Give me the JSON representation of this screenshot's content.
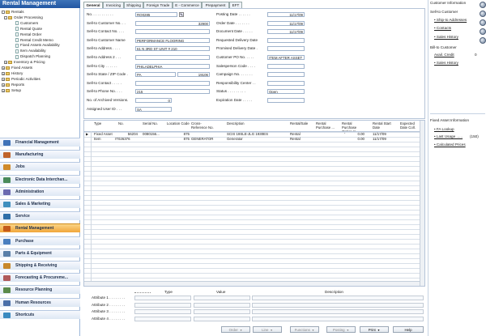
{
  "nav": {
    "title": "Rental Management",
    "tree": [
      {
        "label": "Rentals",
        "expand": "-",
        "icon": "folder"
      },
      {
        "label": "Order Processing",
        "expand": "-",
        "icon": "folder"
      },
      {
        "label": "Customers",
        "expand": "",
        "icon": "doc"
      },
      {
        "label": "Rental Quote",
        "expand": "",
        "icon": "doc"
      },
      {
        "label": "Rental Order",
        "expand": "",
        "icon": "doc"
      },
      {
        "label": "Rental Credit Memo",
        "expand": "",
        "icon": "doc"
      },
      {
        "label": "Fixed Assets Availability",
        "expand": "",
        "icon": "doc"
      },
      {
        "label": "Item Availability",
        "expand": "",
        "icon": "doc"
      },
      {
        "label": "Dispatch Planning",
        "expand": "",
        "icon": "doc"
      },
      {
        "label": "Inventory & Pricing",
        "expand": "+",
        "icon": "folder"
      },
      {
        "label": "Fixed Assets",
        "expand": "+",
        "icon": "folder"
      },
      {
        "label": "History",
        "expand": "+",
        "icon": "folder"
      },
      {
        "label": "Periodic Activities",
        "expand": "+",
        "icon": "folder"
      },
      {
        "label": "Reports",
        "expand": "+",
        "icon": "folder"
      },
      {
        "label": "Setup",
        "expand": "+",
        "icon": "folder"
      }
    ],
    "categories": [
      {
        "label": "Financial Management",
        "color": "#3f72b8",
        "active": false
      },
      {
        "label": "Manufacturing",
        "color": "#c0642a",
        "active": false
      },
      {
        "label": "Jobs",
        "color": "#d08a2a",
        "active": false
      },
      {
        "label": "Electronic Data Interchan...",
        "color": "#4a8a5a",
        "active": false
      },
      {
        "label": "Administration",
        "color": "#6a6ab0",
        "active": false
      },
      {
        "label": "Sales & Marketing",
        "color": "#3f8fbf",
        "active": false
      },
      {
        "label": "Service",
        "color": "#2f6fa8",
        "active": false
      },
      {
        "label": "Rental Management",
        "color": "#c45a1a",
        "active": true
      },
      {
        "label": "Purchase",
        "color": "#4a7fbf",
        "active": false
      },
      {
        "label": "Parts & Equipment",
        "color": "#5a7fa8",
        "active": false
      },
      {
        "label": "Shipping & Receiving",
        "color": "#c8882a",
        "active": false
      },
      {
        "label": "Forecasting & Procureme...",
        "color": "#b05a5a",
        "active": false
      },
      {
        "label": "Resource Planning",
        "color": "#5a8a4a",
        "active": false
      },
      {
        "label": "Human Resources",
        "color": "#4a6fa8",
        "active": false
      },
      {
        "label": "Shortcuts",
        "color": "#3a8ac0",
        "active": false
      }
    ]
  },
  "tabs": [
    "General",
    "Invoicing",
    "Shipping",
    "Foreign Trade",
    "E - Commerce",
    "Prepayment",
    "EFT"
  ],
  "form": {
    "left": [
      {
        "label": "No. . . . . . . . . . .",
        "value": "RO0285",
        "edit": true
      },
      {
        "label": "Sell-to Customer No. . .",
        "value": "32900",
        "right": true
      },
      {
        "label": "Sell-to Contact No. . . .",
        "value": ""
      },
      {
        "label": "Sell-to Customer Name",
        "value": "PERFORMANCE FLOORING"
      },
      {
        "label": "Sell-to Address . . . .",
        "value": "61 N 3RD ST  UNIT # 210"
      },
      {
        "label": "Sell-to Address 2 . . .",
        "value": ""
      },
      {
        "label": "Sell-to City . . . . . .",
        "value": "PHILADELPHIA"
      },
      {
        "label": "Sell-to State / ZIP Code .",
        "value": "PA",
        "value2": "19106"
      },
      {
        "label": "Sell-to Contact . . . . .",
        "value": ""
      },
      {
        "label": "Sell-to Phone No. . . .",
        "value": "215"
      },
      {
        "label": "No. of Archived Versions.",
        "value": "0",
        "right": true,
        "short": true
      },
      {
        "label": "Assigned User ID . . .",
        "value": "SA",
        "short": true
      }
    ],
    "right": [
      {
        "label": "Posting Date . . . . . .",
        "value": "11/17/09",
        "right": true
      },
      {
        "label": "Order Date . . . . . . .",
        "value": "11/17/09",
        "right": true
      },
      {
        "label": "Document Date . . . . .",
        "value": "11/17/09",
        "right": true
      },
      {
        "label": "Requested Delivery Date",
        "value": ""
      },
      {
        "label": "Promised Delivery Date .",
        "value": ""
      },
      {
        "label": "Customer PO No. . . . .",
        "value": "ITEM AFTER ASSET"
      },
      {
        "label": "Salesperson Code . . . .",
        "value": ""
      },
      {
        "label": "Campaign No. . . . . . .",
        "value": ""
      },
      {
        "label": "Responsibility Center . .",
        "value": ""
      },
      {
        "label": "Status . . . . . . . . .",
        "value": "Open"
      },
      {
        "label": "Expiration Date . . . . .",
        "value": ""
      }
    ]
  },
  "lines": {
    "headers": [
      "Type",
      "No.",
      "Serial No.",
      "Location Code",
      "Cross-Reference No.",
      "Description",
      "Rental/Sale",
      "Rental Purchase ...",
      "Rental Purchase Option %",
      "Rental Start Date",
      "Expected Date Coll."
    ],
    "rows": [
      [
        "Fixed Asset",
        "56204",
        "0080156...",
        "875",
        "",
        "SCIS 19SLE-JLG 1930ES",
        "Rental",
        "",
        "0.00",
        "11/17/09",
        ""
      ],
      [
        "Item",
        "IT026376",
        "",
        "875",
        "GENERATOR P...",
        "Generator",
        "Rental",
        "",
        "0.00",
        "11/17/09",
        ""
      ]
    ]
  },
  "attributes": {
    "headers": [
      "Type",
      "Value",
      "Description"
    ],
    "rows": [
      "Attribute 1 . . . . . . . .",
      "Attribute 2 . . . . . . . .",
      "Attribute 3 . . . . . . . .",
      "Attribute 4 . . . . . . . ."
    ]
  },
  "buttons": [
    {
      "label": "Order",
      "enabled": false,
      "dropdown": true
    },
    {
      "label": "Line",
      "enabled": false,
      "dropdown": true
    },
    {
      "label": "Functions",
      "enabled": false,
      "dropdown": true
    },
    {
      "label": "Posting",
      "enabled": false,
      "dropdown": true
    },
    {
      "label": "Print",
      "enabled": true,
      "dropdown": true
    },
    {
      "label": "Help",
      "enabled": true,
      "dropdown": false
    }
  ],
  "factbox": {
    "customer_title": "Customer Information",
    "sell_to": "Sell-to Customer",
    "sell_items": [
      "Ship-to Addresses",
      "Contacts",
      "Sales History"
    ],
    "bill_to": "Bill-to Customer",
    "avail_credit_label": "Avail. Credit",
    "avail_credit_value": "0",
    "bill_items": [
      "Sales History"
    ],
    "fa_title": "Fixed Asset Information",
    "fa_items": [
      {
        "label": "FA Lookup",
        "value": ""
      },
      {
        "label": "Last Usage ......",
        "value": "(150)"
      },
      {
        "label": "Calculated Prices",
        "value": ""
      }
    ]
  }
}
